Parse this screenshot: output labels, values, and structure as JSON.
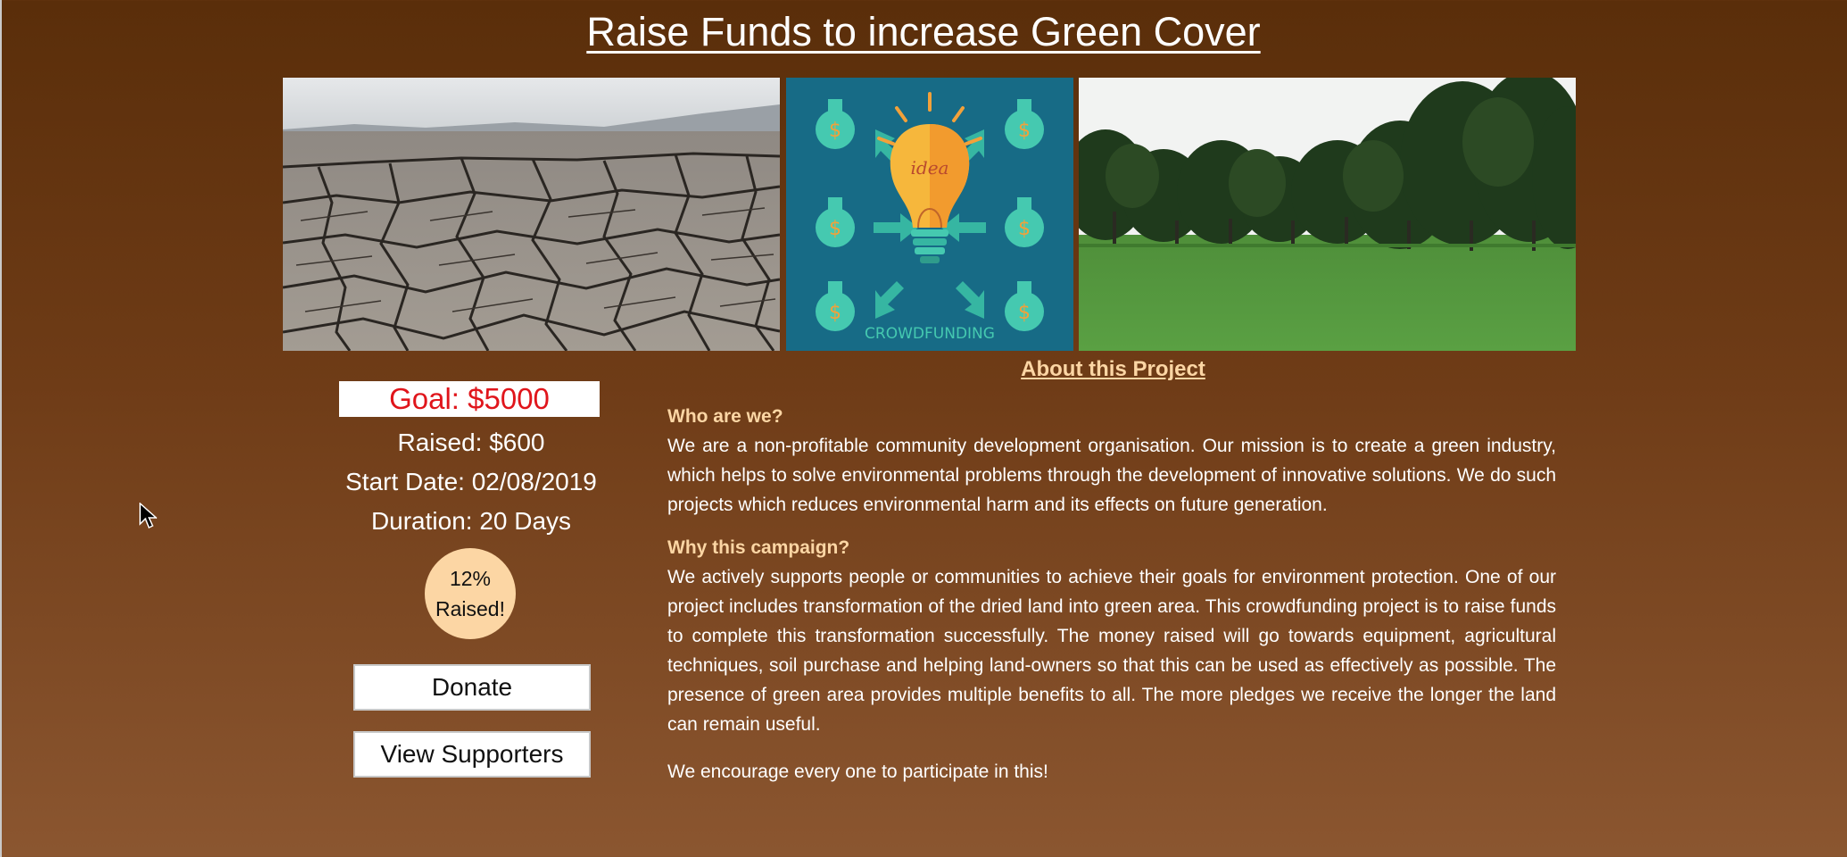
{
  "page": {
    "title": "Raise Funds to increase Green Cover"
  },
  "gallery": {
    "image_2_caption_top": "idea",
    "image_2_caption_bottom": "CROWDFUNDING",
    "bag_symbol": "$"
  },
  "campaign": {
    "goal": "Goal: $5000",
    "raised": "Raised: $600",
    "start_date": "Start Date: 02/08/2019",
    "duration": "Duration: 20 Days",
    "percent_line1": "12%",
    "percent_line2": "Raised!",
    "progress_fraction": 0.12
  },
  "actions": {
    "donate_label": "Donate",
    "view_supporters_label": "View Supporters"
  },
  "about": {
    "link_text": "About this Project",
    "who_heading": "Who are we?",
    "who_text": "We are a non-profitable community development organisation. Our mission is to create a green industry, which helps to solve environmental problems through the development of innovative solutions. We do such projects which reduces environmental harm and its effects on future generation.",
    "why_heading": "Why this campaign?",
    "why_text": "We actively supports people or communities to achieve their goals for environment protection. One of our project includes transformation of the dried land into green area. This crowdfunding project is to raise funds to complete this transformation successfully. The money raised will go towards equipment, agricultural techniques, soil purchase and helping land-owners so that this can be used as effectively as possible. The presence of green area provides multiple benefits to all. The more pledges we receive the longer the land can remain useful.",
    "closing_text": "We encourage every one to participate in this!"
  },
  "colors": {
    "background_top": "#5a2e0a",
    "background_bottom": "#8b5630",
    "accent_peach": "#fcd6a4",
    "goal_red": "#e0151b"
  },
  "icons": [
    "mouse-cursor-icon",
    "money-bag-icon",
    "lightbulb-icon"
  ]
}
